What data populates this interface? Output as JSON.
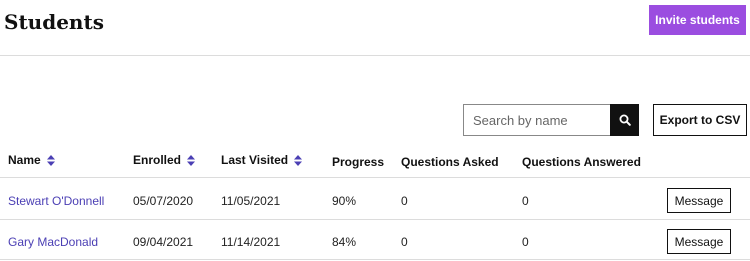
{
  "header": {
    "title": "Students",
    "invite_label": "Invite students"
  },
  "toolbar": {
    "search_placeholder": "Search by name",
    "search_value": "",
    "search_icon": "magnifier-icon",
    "export_label": "Export to CSV"
  },
  "table": {
    "columns": {
      "name": "Name",
      "enrolled": "Enrolled",
      "last_visited": "Last Visited",
      "progress": "Progress",
      "questions_asked": "Questions Asked",
      "questions_answered": "Questions Answered"
    },
    "sort_icon": "sort-up-down-icon",
    "rows": [
      {
        "name": "Stewart O'Donnell",
        "enrolled": "05/07/2020",
        "last_visited": "11/05/2021",
        "progress": "90%",
        "questions_asked": "0",
        "questions_answered": "0",
        "action_label": "Message"
      },
      {
        "name": "Gary MacDonald",
        "enrolled": "09/04/2021",
        "last_visited": "11/14/2021",
        "progress": "84%",
        "questions_asked": "0",
        "questions_answered": "0",
        "action_label": "Message"
      }
    ]
  },
  "colors": {
    "accent": "#9b4de0",
    "link": "#4b3fb4",
    "sort_icon": "#4b3fb4"
  }
}
